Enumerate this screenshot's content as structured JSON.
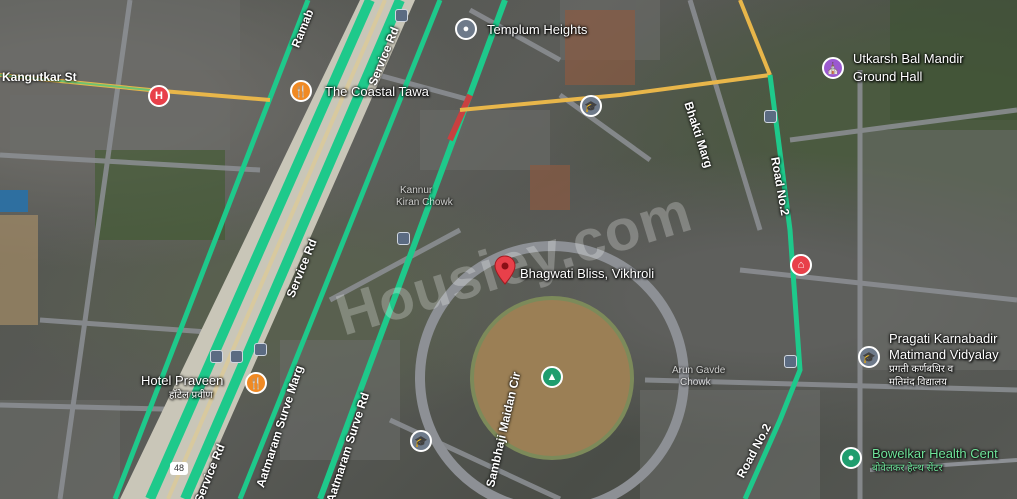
{
  "colors": {
    "traffic_green": "#1ec98b",
    "traffic_yellow": "#e8b64a",
    "road_gray": "#8d9095",
    "pin_red": "#e8404a",
    "pin_orange": "#f08a24",
    "pin_purple": "#9b59d0",
    "pin_gray": "#6e7a8a",
    "pin_teal": "#1f9d6e"
  },
  "watermark": "Housiey.com",
  "roads": {
    "kangutkar": "Kangutkar St",
    "ramabai": "Ramab",
    "service_rd_1": "Service Rd",
    "service_rd_2": "Service Rd",
    "service_rd_3": "Service Rd",
    "bhakti_marg": "Bhakti Marg",
    "road_no2_a": "Road No.2",
    "road_no2_b": "Road No.2",
    "surve_marg_1": "Aatmaram Surve Marg",
    "surve_marg_2": "Aatmaram Surve Rd",
    "sambhaji": "Sambhaji Maidan Cir",
    "highway_shield": "48"
  },
  "places": {
    "templum": {
      "name": "Templum Heights",
      "icon": "place-icon"
    },
    "coastal": {
      "name": "The Coastal Tawa",
      "icon": "restaurant-icon"
    },
    "utkarsh": {
      "name_line1": "Utkarsh Bal Mandir",
      "name_line2": "Ground Hall",
      "icon": "temple-icon"
    },
    "bhagwati": {
      "name": "Bhagwati Bliss, Vikhroli",
      "icon": "location-pin-icon"
    },
    "pragati": {
      "name_line1": "Pragati Karnabadir",
      "name_line2": "Matimand Vidyalay",
      "marathi_line1": "प्रगती कर्णबधिर व",
      "marathi_line2": "मतिमंद विद्यालय",
      "icon": "school-icon"
    },
    "hotel_praveen": {
      "name": "Hotel Praveen",
      "marathi": "हॉटेल प्रवीण",
      "icon": "restaurant-icon"
    },
    "bowelkar": {
      "name": "Bowelkar Health Cent",
      "marathi": "बोवेलकर हेल्थ सेंटर",
      "icon": "health-icon"
    },
    "kanjur_chowk": {
      "name_line1": "Kannur",
      "name_line2": "Kiran Chowk"
    },
    "arun_chowk": {
      "name_line1": "Arun Gavde",
      "name_line2": "Chowk"
    }
  },
  "marker_icons": {
    "hospital": "H",
    "restaurant": "🍴",
    "temple": "⛪",
    "place": "●",
    "school": "🎓",
    "park": "▲",
    "shop": "⌂",
    "health": "●",
    "bus": "▣"
  }
}
